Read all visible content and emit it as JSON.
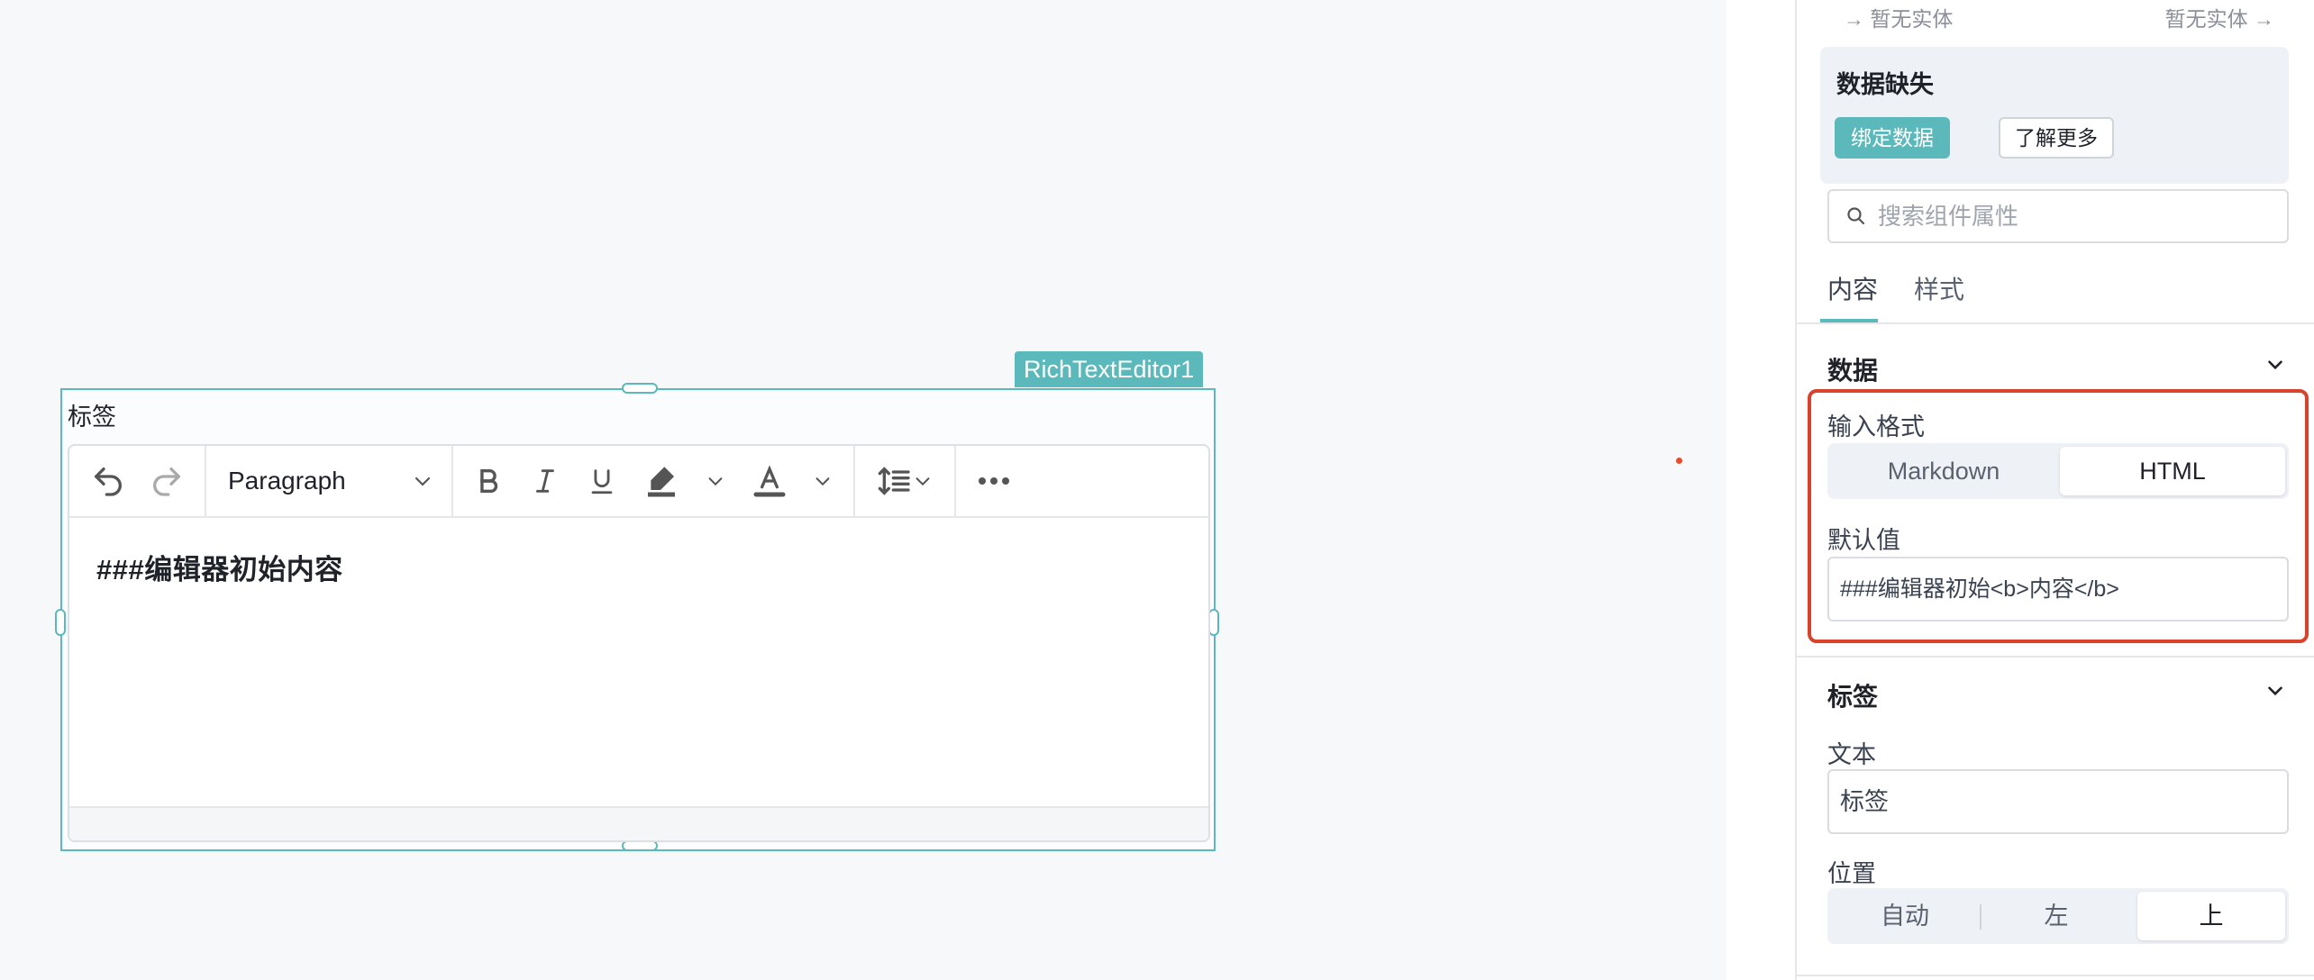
{
  "canvas": {
    "component_tag": "RichTextEditor1",
    "editor": {
      "label": "标签",
      "paragraph_select": "Paragraph",
      "content_plain": "###编辑器初始",
      "content_bold": "内容"
    }
  },
  "panel": {
    "entity_left": "暂无实体",
    "entity_right": "暂无实体",
    "missing": {
      "title": "数据缺失",
      "bind_button": "绑定数据",
      "learn_button": "了解更多"
    },
    "search": {
      "placeholder": "搜索组件属性",
      "value": ""
    },
    "tabs": [
      {
        "label": "内容",
        "active": true
      },
      {
        "label": "样式",
        "active": false
      }
    ],
    "data_section": {
      "title": "数据",
      "input_format_label": "输入格式",
      "input_format_options": [
        "Markdown",
        "HTML"
      ],
      "input_format_selected": "HTML",
      "default_value_label": "默认值",
      "default_value": "###编辑器初始<b>内容</b>"
    },
    "label_section": {
      "title": "标签",
      "text_label": "文本",
      "text_value": "标签",
      "position_label": "位置",
      "position_options": [
        "自动",
        "左",
        "上"
      ],
      "position_selected": "上"
    }
  },
  "colors": {
    "accent": "#5bb8bb",
    "highlight": "#d9432e"
  }
}
